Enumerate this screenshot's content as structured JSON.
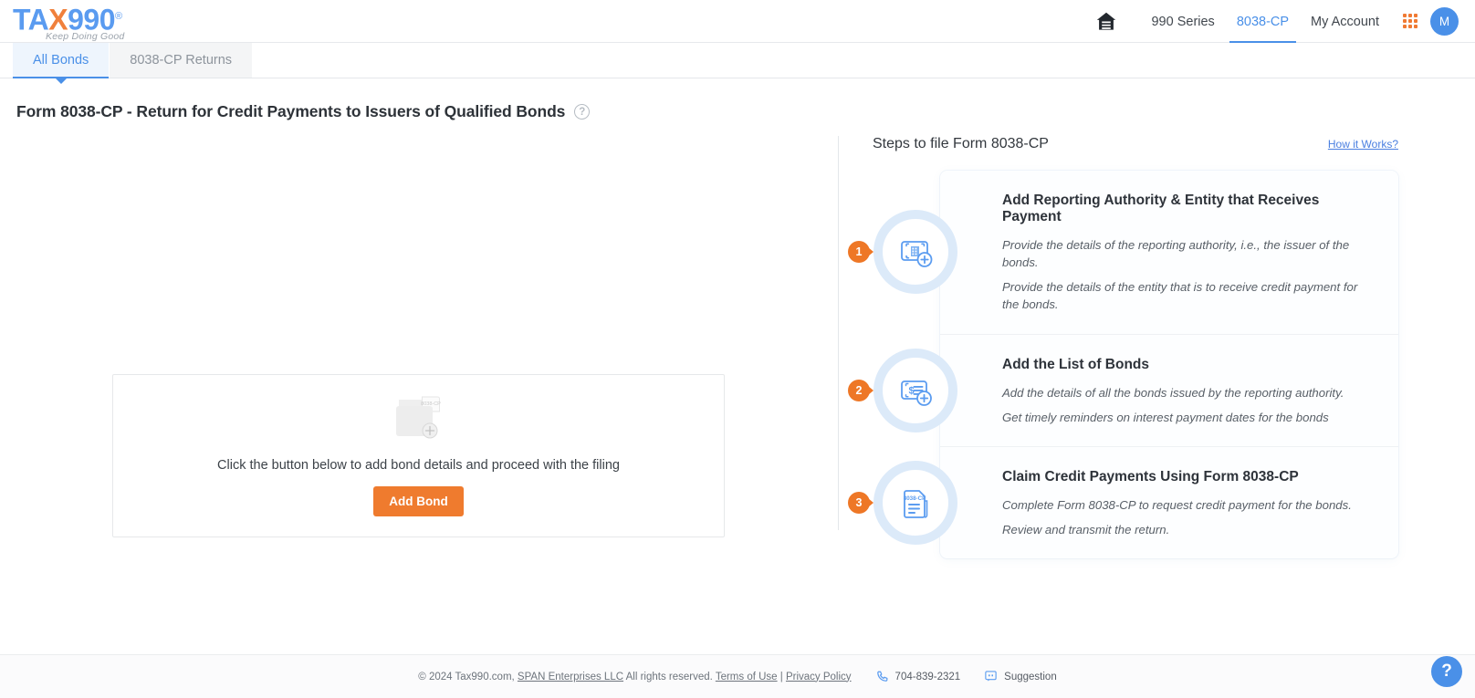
{
  "header": {
    "logo": {
      "part1": "TA",
      "slash": "X",
      "part2": "990",
      "reg": "®",
      "tagline": "Keep Doing Good"
    },
    "nav": [
      {
        "label": "990 Series",
        "active": false
      },
      {
        "label": "8038-CP",
        "active": true
      },
      {
        "label": "My Account",
        "active": false
      }
    ],
    "home_icon": "home-icon",
    "apps_icon": "apps-grid-icon",
    "avatar_initial": "M"
  },
  "tabs": [
    {
      "label": "All Bonds",
      "active": true
    },
    {
      "label": "8038-CP Returns",
      "active": false
    }
  ],
  "page": {
    "title": "Form 8038-CP - Return for Credit Payments to Issuers of Qualified Bonds",
    "help_icon": "question-mark-icon"
  },
  "empty_state": {
    "folder_label": "8038-CP",
    "message": "Click the button below to add bond details and proceed with the filing",
    "button_label": "Add Bond"
  },
  "steps_panel": {
    "title": "Steps to file Form 8038-CP",
    "how_it_works": "How it Works?",
    "steps": [
      {
        "number": "1",
        "title": "Add Reporting Authority & Entity that Receives Payment",
        "lines": [
          "Provide the details of the reporting authority, i.e., the issuer of the bonds.",
          "Provide the details of the entity that is to receive credit payment for the bonds."
        ],
        "icon": "building-add-icon"
      },
      {
        "number": "2",
        "title": "Add the List of Bonds",
        "lines": [
          "Add the details of all the bonds issued by the reporting authority.",
          "Get timely reminders on interest payment dates for the bonds"
        ],
        "icon": "bond-card-add-icon"
      },
      {
        "number": "3",
        "title": "Claim Credit Payments Using Form 8038-CP",
        "lines": [
          "Complete Form 8038-CP to request credit payment for the bonds.",
          "Review and transmit the return."
        ],
        "icon": "form-document-icon",
        "icon_label": "8038-CP"
      }
    ]
  },
  "footer": {
    "copyright_pre": "© 2024 Tax990.com, ",
    "company_link": "SPAN Enterprises LLC",
    "copyright_mid": " All rights reserved. ",
    "terms_link": "Terms of Use",
    "separator": " | ",
    "privacy_link": "Privacy Policy",
    "phone": "704-839-2321",
    "suggestion": "Suggestion",
    "help_fab": "?"
  },
  "colors": {
    "brand_blue": "#4a90e8",
    "accent_orange": "#ef7b2e",
    "ring_blue": "#dceaf9"
  }
}
